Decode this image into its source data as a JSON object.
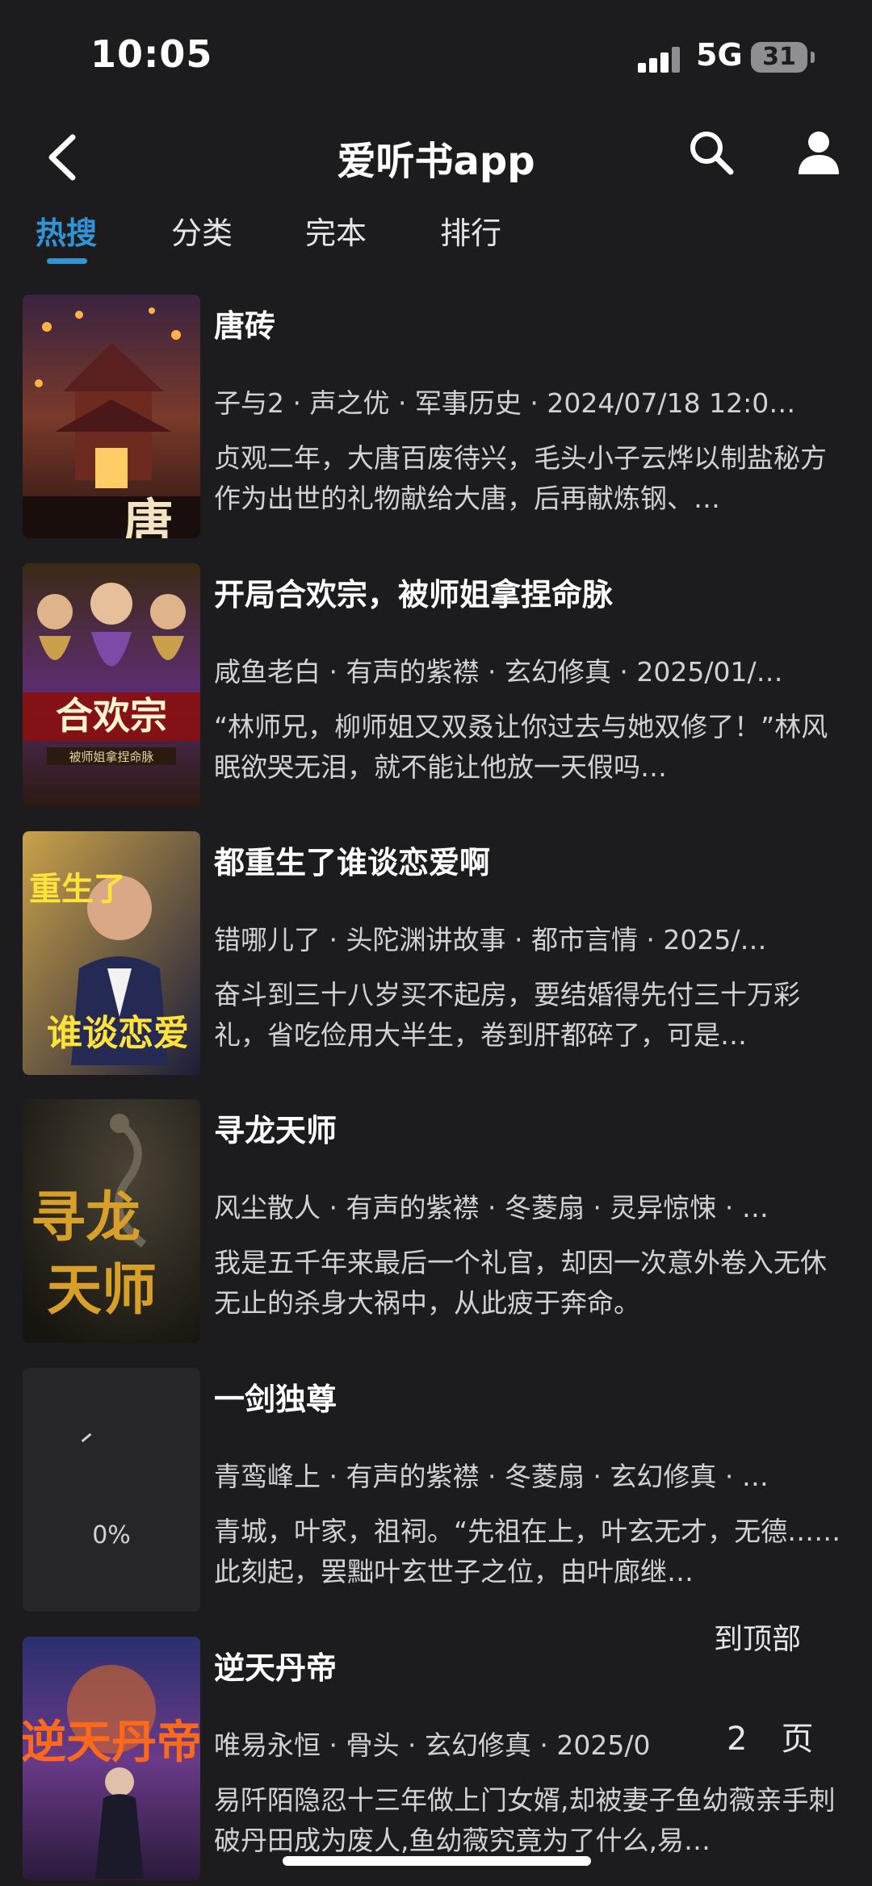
{
  "status_bar": {
    "time": "10:05",
    "network": "5G",
    "battery": "31"
  },
  "header": {
    "title": "爱听书app"
  },
  "tabs": [
    {
      "label": "热搜",
      "active": true
    },
    {
      "label": "分类",
      "active": false
    },
    {
      "label": "完本",
      "active": false
    },
    {
      "label": "排行",
      "active": false
    }
  ],
  "books": [
    {
      "title": "唐砖",
      "meta": "子与2 · 声之优 · 军事历史 · 2024/07/18 12:0…",
      "desc": "贞观二年，大唐百废待兴，毛头小子云烨以制盐秘方作为出世的礼物献给大唐，后再献炼钢、…"
    },
    {
      "title": "开局合欢宗，被师姐拿捏命脉",
      "meta": "咸鱼老白 · 有声的紫襟 · 玄幻修真 · 2025/01/…",
      "desc": "“林师兄，柳师姐又双叒让你过去与她双修了！”林风眠欲哭无泪，就不能让他放一天假吗…"
    },
    {
      "title": "都重生了谁谈恋爱啊",
      "meta": "错哪儿了 · 头陀渊讲故事 · 都市言情 · 2025/…",
      "desc": "奋斗到三十八岁买不起房，要结婚得先付三十万彩礼，省吃俭用大半生，卷到肝都碎了，可是…"
    },
    {
      "title": "寻龙天师",
      "meta": "风尘散人 · 有声的紫襟 · 冬菱扇 · 灵异惊悚 · …",
      "desc": "我是五千年来最后一个礼官，却因一次意外卷入无休无止的杀身大祸中，从此疲于奔命。"
    },
    {
      "title": "一剑独尊",
      "meta": "青鸾峰上 · 有声的紫襟 · 冬菱扇 · 玄幻修真 · …",
      "desc": "青城，叶家，祖祠。“先祖在上，叶玄无才，无德……此刻起，罢黜叶玄世子之位，由叶廊继…",
      "cover_loading": "0%"
    },
    {
      "title": "逆天丹帝",
      "meta": "唯易永恒 · 骨头 · 玄幻修真 · 2025/0",
      "desc": "易阡陌隐忍十三年做上门女婿,却被妻子鱼幼薇亲手刺破丹田成为废人,鱼幼薇究竟为了什么,易…"
    }
  ],
  "covers": {
    "book1": "唐砖",
    "book2": "合欢宗",
    "book2_sub": "被师姐拿捏命脉",
    "book3a": "重生了",
    "book3b": "谁谈恋爱",
    "book4": "寻龙天师",
    "book6": "逆天丹帝"
  },
  "floating": {
    "to_top": "到顶部",
    "page_num": "2",
    "page_unit": "页"
  },
  "colors": {
    "accent": "#2f95d6",
    "background": "#1c1c1e"
  }
}
